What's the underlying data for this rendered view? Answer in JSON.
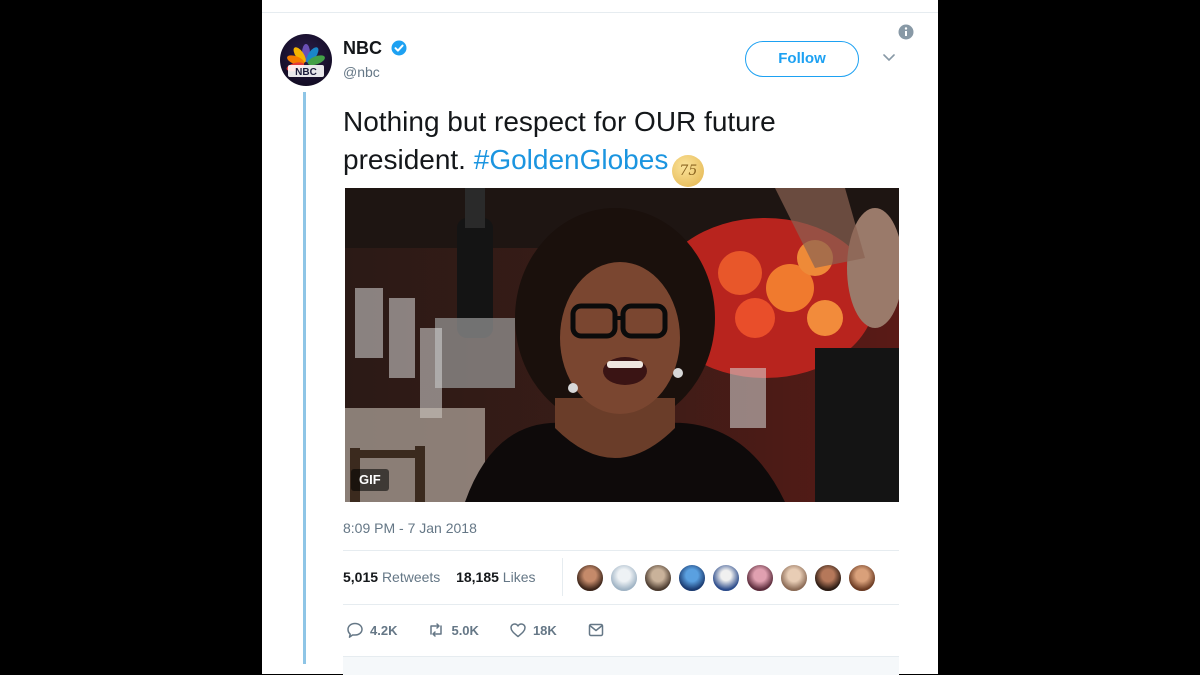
{
  "tweet": {
    "author_name": "NBC",
    "handle": "@nbc",
    "avatar_text": "NBC",
    "follow_label": "Follow",
    "text_main": "Nothing but respect for OUR future president. ",
    "hashtag": "#GoldenGlobes",
    "hashflag_text": "75",
    "media_badge": "GIF",
    "timestamp": "8:09 PM - 7 Jan 2018",
    "retweets_count": "5,015",
    "retweets_label": "Retweets",
    "likes_count": "18,185",
    "likes_label": "Likes",
    "reply_count": "4.2K",
    "retweet_count_short": "5.0K",
    "like_count_short": "18K"
  },
  "icons": [
    "nbc-peacock-icon",
    "verified-badge-icon",
    "chevron-down-icon",
    "info-icon",
    "reply-icon",
    "retweet-icon",
    "like-icon",
    "message-icon"
  ],
  "colors": {
    "accent": "#1da1f2",
    "hashtag": "#1b95e0",
    "muted": "#657786",
    "thread": "#8ec5e6"
  }
}
